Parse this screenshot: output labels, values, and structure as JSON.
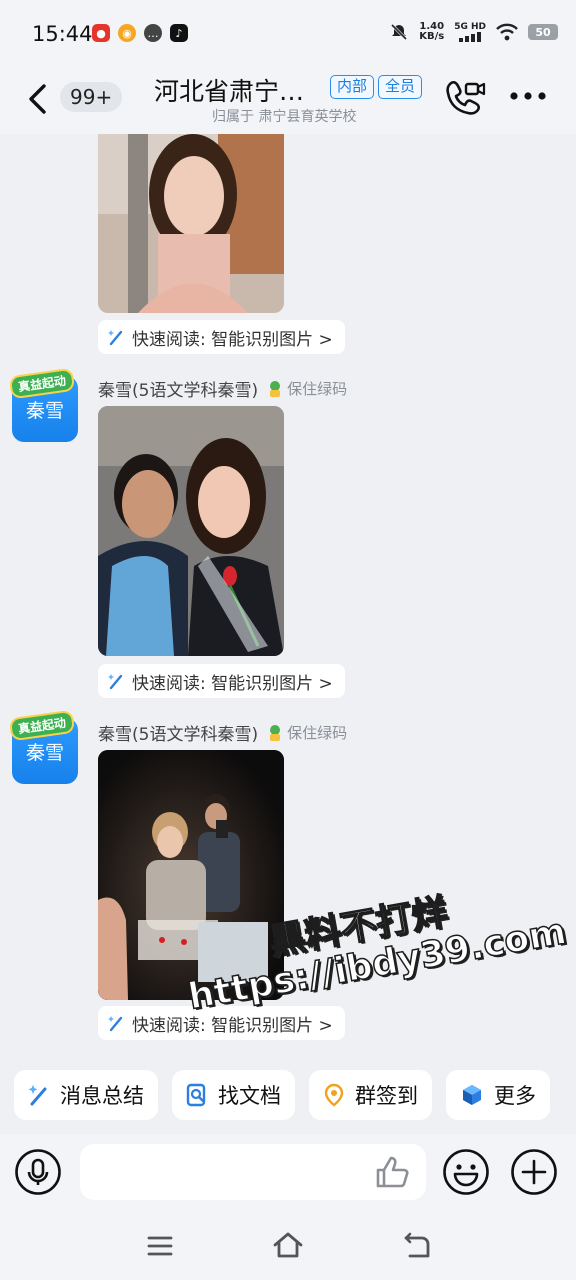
{
  "status_bar": {
    "time": "15:44",
    "net_speed_value": "1.40",
    "net_speed_unit": "KB/s",
    "net_type": "5G HD",
    "battery": "50",
    "app_icons": [
      "netease-music-icon",
      "weibo-icon",
      "message-icon",
      "tiktok-icon"
    ],
    "right_icons": [
      "mute-icon",
      "signal-icon",
      "wifi-icon",
      "battery-icon"
    ]
  },
  "header": {
    "unread_count": "99+",
    "title": "河北省肃宁…",
    "tag_internal": "内部",
    "tag_all": "全员",
    "subtitle": "归属于 肃宁县育英学校"
  },
  "messages": [
    {
      "quick_read": "快速阅读: 智能识别图片 >"
    },
    {
      "avatar_badge": "真益起动",
      "avatar_text": "秦雪",
      "sender": "秦雪(5语文学科秦雪)",
      "health_code": "保住绿码",
      "quick_read": "快速阅读: 智能识别图片 >"
    },
    {
      "avatar_badge": "真益起动",
      "avatar_text": "秦雪",
      "sender": "秦雪(5语文学科秦雪)",
      "health_code": "保住绿码",
      "quick_read": "快速阅读: 智能识别图片 >"
    }
  ],
  "watermark": {
    "line1": "黑料不打烊",
    "line2": "https://ibdy39.com"
  },
  "quick_actions": [
    {
      "label": "消息总结",
      "icon": "sparkle-icon"
    },
    {
      "label": "找文档",
      "icon": "document-search-icon"
    },
    {
      "label": "群签到",
      "icon": "location-pin-icon"
    },
    {
      "label": "更多",
      "icon": "cube-icon"
    }
  ],
  "input": {
    "placeholder": ""
  },
  "colors": {
    "accent": "#1a7fe0",
    "background": "#eef0f4",
    "avatar": "#1681ea"
  }
}
